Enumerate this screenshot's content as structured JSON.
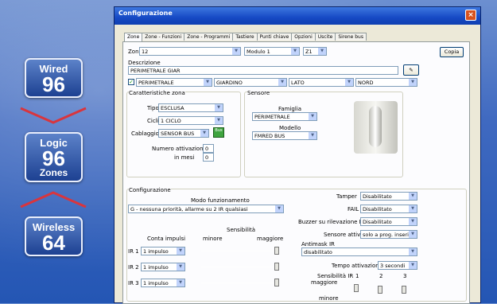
{
  "badges": {
    "wired": {
      "label": "Wired",
      "value": "96"
    },
    "logic": {
      "label": "Logic",
      "value": "96",
      "sub": "Zones"
    },
    "wireless": {
      "label": "Wireless",
      "value": "64"
    }
  },
  "window": {
    "title": "Configurazione",
    "close": "×"
  },
  "tabs": [
    "Zone",
    "Zone - Funzioni",
    "Zone - Programmi",
    "Tastiere",
    "Punti chiave",
    "Opzioni",
    "Uscite",
    "Sirene bus"
  ],
  "top": {
    "zona_label": "Zona",
    "zona_value": "12",
    "modulo_value": "Modulo 1",
    "z_value": "Z1",
    "copia": "Copia"
  },
  "descr": {
    "label": "Descrizione",
    "value": "PERIMETRALE GIAR",
    "fields": [
      "PERIMETRALE",
      "GIARDINO",
      "LATO",
      "NORD"
    ]
  },
  "caratt": {
    "title": "Caratteristiche zona",
    "tipo_label": "Tipo",
    "tipo_value": "ESCLUSA",
    "cicli_label": "Cicli",
    "cicli_value": "1 CICLO",
    "cablaggio_label": "Cablaggio",
    "cablaggio_value": "SENSOR BUS",
    "green_btn": "Bus",
    "num_label": "Numero attivazioni",
    "num_value": "0",
    "mesi_label": "in mesi",
    "mesi_value": "0"
  },
  "sensore": {
    "title": "Sensore",
    "famiglia_label": "Famiglia",
    "famiglia_value": "PERIMETRALE",
    "modello_label": "Modello",
    "modello_value": "FMRED BUS"
  },
  "config": {
    "title": "Configurazione",
    "modo_label": "Modo funzionamento",
    "modo_value": "G - nessuna priorità, allarme su 2 IR qualsiasi",
    "sensibilita": "Sensibilità",
    "conta": "Conta impulsi",
    "minore": "minore",
    "maggiore": "maggiore",
    "ir_rows": [
      {
        "label": "IR 1",
        "value": "1 impulso"
      },
      {
        "label": "IR 2",
        "value": "1 impulso"
      },
      {
        "label": "IR 3",
        "value": "1 impulso"
      }
    ],
    "right": [
      {
        "label": "Tamper",
        "value": "Disabilitato"
      },
      {
        "label": "FAIL",
        "value": "Disabilitato"
      },
      {
        "label": "Buzzer su rilevazione IR",
        "value": "Disabilitato"
      },
      {
        "label": "Sensore attivo",
        "value": "solo a prog. inseriti"
      }
    ],
    "antimask_label": "Antimask IR",
    "antimask_value": "disabilitato",
    "tempo_label": "Tempo attivazione",
    "tempo_value": "3 secondi",
    "sens_ir": "Sensibilità IR",
    "maggiore2": "maggiore",
    "minore2": "minore",
    "cols": [
      "1",
      "2",
      "3"
    ]
  }
}
